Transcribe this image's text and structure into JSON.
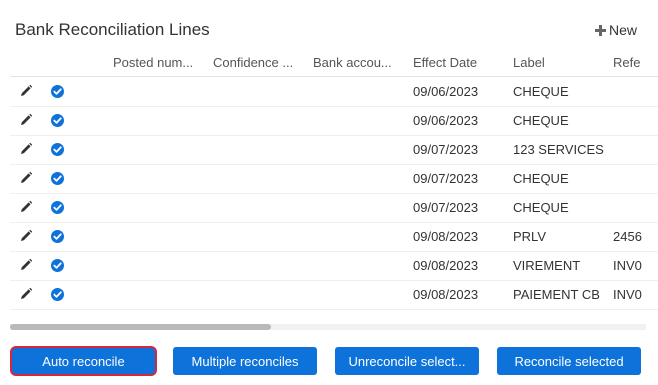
{
  "panel": {
    "title": "Bank Reconciliation Lines",
    "new_label": "New"
  },
  "table": {
    "headers": [
      "Posted num...",
      "Confidence ...",
      "Bank accou...",
      "Effect Date",
      "Label",
      "Refe"
    ],
    "rows": [
      {
        "date": "09/06/2023",
        "label": "CHEQUE",
        "ref": ""
      },
      {
        "date": "09/06/2023",
        "label": "CHEQUE",
        "ref": ""
      },
      {
        "date": "09/07/2023",
        "label": "123 SERVICES",
        "ref": ""
      },
      {
        "date": "09/07/2023",
        "label": "CHEQUE",
        "ref": ""
      },
      {
        "date": "09/07/2023",
        "label": "CHEQUE",
        "ref": ""
      },
      {
        "date": "09/08/2023",
        "label": "PRLV",
        "ref": "2456"
      },
      {
        "date": "09/08/2023",
        "label": "VIREMENT",
        "ref": "INV0"
      },
      {
        "date": "09/08/2023",
        "label": "PAIEMENT CB",
        "ref": "INV0"
      }
    ]
  },
  "buttons": {
    "auto_reconcile": "Auto reconcile",
    "multiple_reconciles": "Multiple reconciles",
    "unreconcile_selected": "Unreconcile select...",
    "reconcile_selected": "Reconcile selected"
  },
  "colors": {
    "primary": "#0d72d9",
    "highlight_border": "#d6283c"
  },
  "icons": {
    "row_edit": "pencil-icon",
    "row_status": "check-circle-icon",
    "new": "plus-icon"
  }
}
